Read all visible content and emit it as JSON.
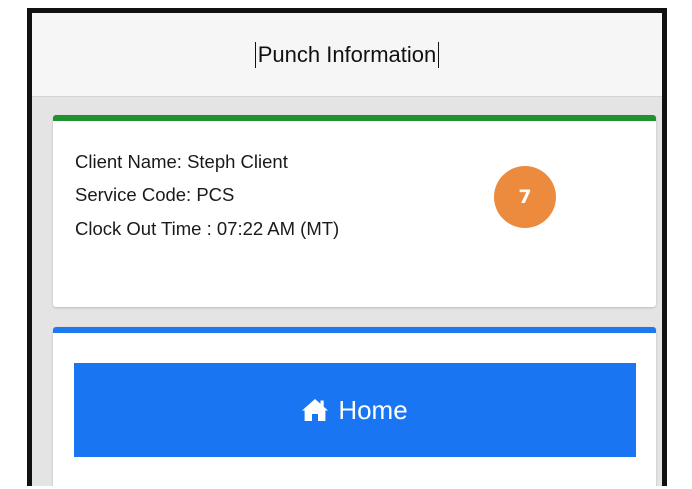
{
  "header": {
    "title": "Punch Information"
  },
  "punch_info": {
    "client_name": "Client Name: Steph Client",
    "service_code": "Service Code: PCS",
    "clock_out_time": "Clock Out Time : 07:22 AM (MT)"
  },
  "annotation": {
    "step_number": "7"
  },
  "navigation": {
    "home_label": "Home",
    "home_icon": "home-icon"
  },
  "colors": {
    "info_card_accent": "#21902f",
    "nav_card_accent": "#1e78f0",
    "home_button_bg": "#1a75f2",
    "badge_bg": "#ec8b3d"
  }
}
